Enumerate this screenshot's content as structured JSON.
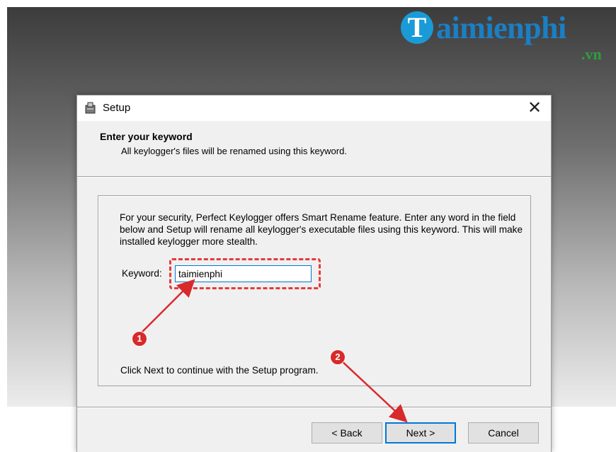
{
  "watermark": {
    "brand_initial": "T",
    "brand_text": "aimienphi",
    "brand_tld": ".vn"
  },
  "window": {
    "title": "Setup",
    "close_glyph": "✕",
    "icon": "setup-package-icon"
  },
  "header": {
    "title": "Enter your keyword",
    "subtitle": "All keylogger's files will be renamed using this keyword."
  },
  "body": {
    "description": "For your security, Perfect Keylogger offers Smart Rename feature. Enter any word in the field below and Setup will rename all keylogger's executable files using this keyword. This will make installed keylogger more stealth.",
    "keyword_label": "Keyword:",
    "keyword_value": "taimienphi",
    "footer_text": "Click Next to continue with the Setup program."
  },
  "buttons": {
    "back": "< Back",
    "next": "Next >",
    "cancel": "Cancel"
  },
  "annotations": {
    "step1": "1",
    "step2": "2",
    "color": "#d8292b"
  }
}
